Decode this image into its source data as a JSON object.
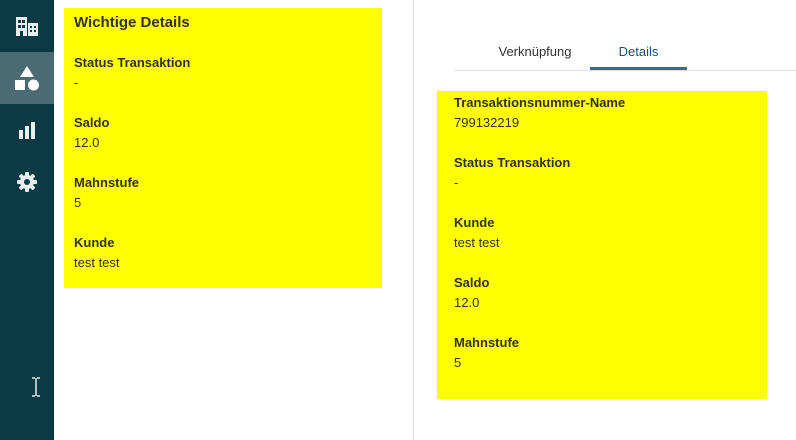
{
  "sidebar": {
    "items": [
      {
        "icon": "building-icon"
      },
      {
        "icon": "shapes-icon",
        "active": true
      },
      {
        "icon": "bar-chart-icon"
      },
      {
        "icon": "gear-icon"
      }
    ],
    "background": "#0b3a45",
    "active_background": "#4a6b73"
  },
  "left_card": {
    "title": "Wichtige Details",
    "fields": [
      {
        "label": "Status Transaktion",
        "value": "-"
      },
      {
        "label": "Saldo",
        "value": "12.0"
      },
      {
        "label": "Mahnstufe",
        "value": "5"
      },
      {
        "label": "Kunde",
        "value": "test test"
      }
    ]
  },
  "tabs": {
    "items": [
      {
        "label": "Verknüpfung"
      },
      {
        "label": "Details",
        "selected": true
      }
    ]
  },
  "right_card": {
    "fields": [
      {
        "label": "Transaktionsnummer-Name",
        "value": "799132219"
      },
      {
        "label": "Status Transaktion",
        "value": "-"
      },
      {
        "label": "Kunde",
        "value": "test test"
      },
      {
        "label": "Saldo",
        "value": "12.0"
      },
      {
        "label": "Mahnstufe",
        "value": "5"
      }
    ]
  },
  "colors": {
    "highlight": "#ffff00",
    "tab_accent": "#2c6ea3"
  }
}
